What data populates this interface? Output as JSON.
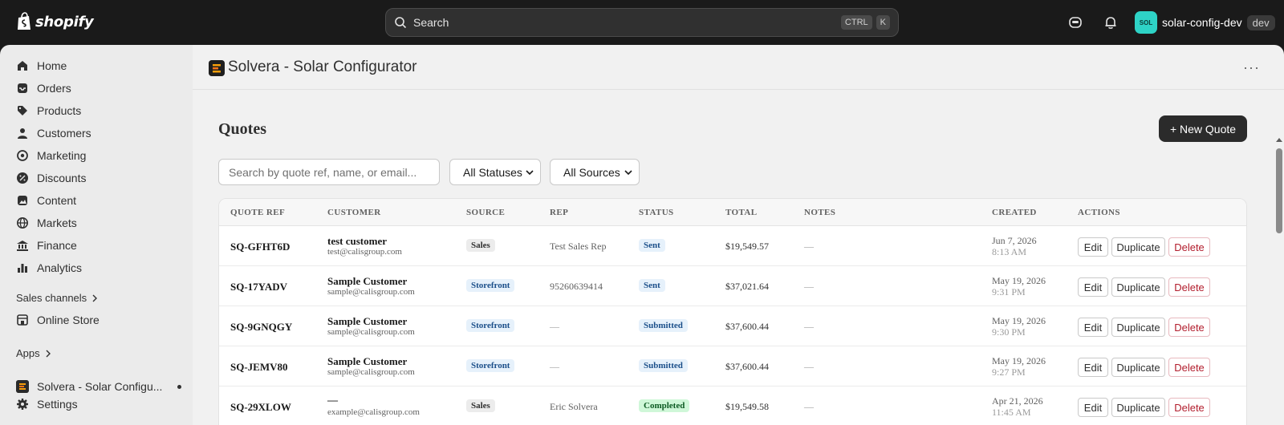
{
  "topbar": {
    "brand": "shopify",
    "search_placeholder": "Search",
    "shortcut_keys": [
      "CTRL",
      "K"
    ],
    "store_avatar": "SOL",
    "store_name": "solar-config-dev",
    "store_badge": "dev"
  },
  "sidebar": {
    "items": [
      {
        "label": "Home",
        "icon": "home-icon"
      },
      {
        "label": "Orders",
        "icon": "inbox-icon"
      },
      {
        "label": "Products",
        "icon": "tag-icon"
      },
      {
        "label": "Customers",
        "icon": "person-icon"
      },
      {
        "label": "Marketing",
        "icon": "target-icon"
      },
      {
        "label": "Discounts",
        "icon": "discount-icon"
      },
      {
        "label": "Content",
        "icon": "image-icon"
      },
      {
        "label": "Markets",
        "icon": "globe-icon"
      },
      {
        "label": "Finance",
        "icon": "bank-icon"
      },
      {
        "label": "Analytics",
        "icon": "chart-icon"
      }
    ],
    "sales_channels_label": "Sales channels",
    "online_store_label": "Online Store",
    "apps_label": "Apps",
    "app_label": "Solvera - Solar Configu...",
    "settings_label": "Settings"
  },
  "app": {
    "title": "Solvera - Solar Configurator",
    "more": "···"
  },
  "page": {
    "heading": "Quotes",
    "new_quote_label": "+ New Quote",
    "search_placeholder": "Search by quote ref, name, or email...",
    "status_filter": "All Statuses",
    "source_filter": "All Sources"
  },
  "table": {
    "columns": [
      "QUOTE REF",
      "CUSTOMER",
      "SOURCE",
      "REP",
      "STATUS",
      "TOTAL",
      "NOTES",
      "CREATED",
      "ACTIONS"
    ],
    "actions": {
      "edit": "Edit",
      "duplicate": "Duplicate",
      "delete": "Delete"
    },
    "rows": [
      {
        "ref": "SQ-GFHT6D",
        "name": "test customer",
        "email": "test@calisgroup.com",
        "source": "Sales",
        "rep": "Test Sales Rep",
        "status": "Sent",
        "total": "$19,549.57",
        "notes": "—",
        "date": "Jun 7, 2026",
        "time": "8:13 AM"
      },
      {
        "ref": "SQ-17YADV",
        "name": "Sample Customer",
        "email": "sample@calisgroup.com",
        "source": "Storefront",
        "rep": "95260639414",
        "status": "Sent",
        "total": "$37,021.64",
        "notes": "—",
        "date": "May 19, 2026",
        "time": "9:31 PM"
      },
      {
        "ref": "SQ-9GNQGY",
        "name": "Sample Customer",
        "email": "sample@calisgroup.com",
        "source": "Storefront",
        "rep": "—",
        "status": "Submitted",
        "total": "$37,600.44",
        "notes": "—",
        "date": "May 19, 2026",
        "time": "9:30 PM"
      },
      {
        "ref": "SQ-JEMV80",
        "name": "Sample Customer",
        "email": "sample@calisgroup.com",
        "source": "Storefront",
        "rep": "—",
        "status": "Submitted",
        "total": "$37,600.44",
        "notes": "—",
        "date": "May 19, 2026",
        "time": "9:27 PM"
      },
      {
        "ref": "SQ-29XLOW",
        "name": "—",
        "email": "example@calisgroup.com",
        "source": "Sales",
        "rep": "Eric Solvera",
        "status": "Completed",
        "total": "$19,549.58",
        "notes": "—",
        "date": "Apr 21, 2026",
        "time": "11:45 AM"
      }
    ]
  }
}
